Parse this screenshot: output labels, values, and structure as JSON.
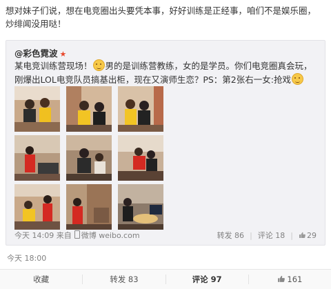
{
  "post": {
    "text": "想对妹子们说，想在电竞圈出头要凭本事，好好训练是正经事，咱们不是娱乐圈，炒绯闻没用哒！",
    "time": "今天 18:00"
  },
  "repost": {
    "author": "@彩色霓波",
    "verified_icon": "star-icon",
    "text_part1": "某电竞训练营现场！",
    "text_part2": "男的是训练营教练，女的是学员。你们电竞圈真会玩，刚爆出LOL电竞队员搞基出柜，现在又演师生恋？PS：第2张右一女:抢戏",
    "meta_time": "今天 14:09 来自",
    "meta_source": "微博 weibo.com",
    "repost_label": "转发 86",
    "comment_label": "评论 18",
    "like_count": "29",
    "photo_count": 9
  },
  "actions": {
    "collect": "收藏",
    "forward": "转发 83",
    "comment": "评论 97",
    "like": "161"
  },
  "colors": {
    "accent": "#e8482c",
    "meta": "#808080",
    "box_bg": "#f2f2f5"
  }
}
